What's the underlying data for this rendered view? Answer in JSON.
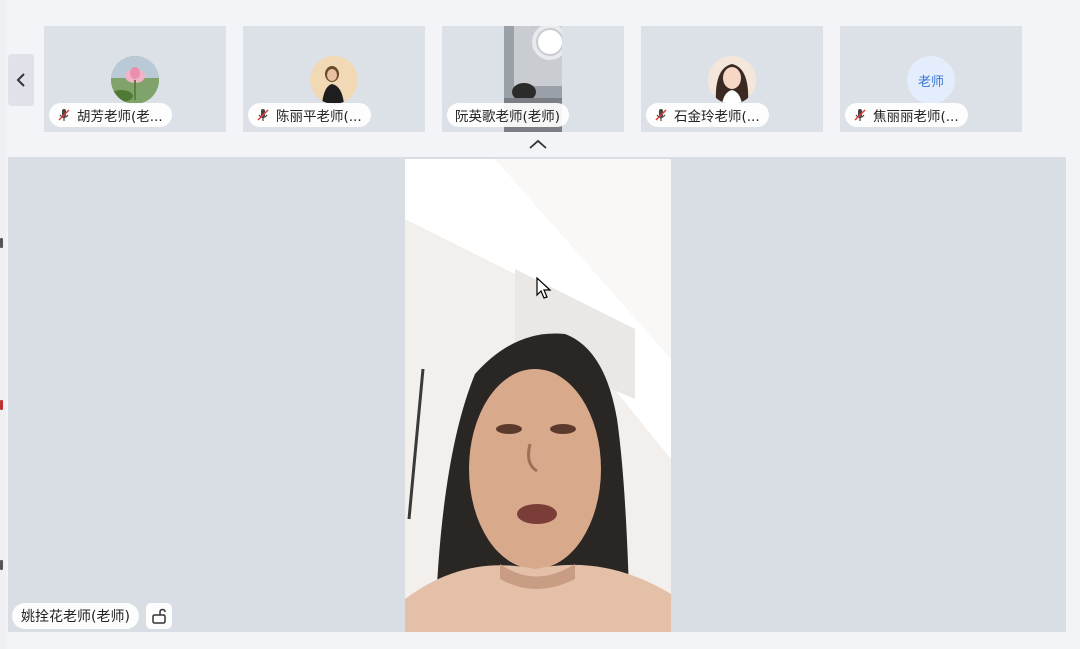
{
  "participants": [
    {
      "name": "胡芳老师(老...",
      "muted": true,
      "avatar": "photo-lotus"
    },
    {
      "name": "陈丽平老师(...",
      "muted": true,
      "avatar": "photo-woman"
    },
    {
      "name": "阮英歌老师(老师)",
      "muted": false,
      "avatar": "live-video"
    },
    {
      "name": "石金玲老师(...",
      "muted": true,
      "avatar": "photo-portrait"
    },
    {
      "name": "焦丽丽老师(...",
      "muted": true,
      "avatar": "text",
      "avatar_text": "老师"
    }
  ],
  "main_speaker": {
    "name": "姚拴花老师(老师)"
  },
  "icons": {
    "prev": "chevron-left-icon",
    "collapse": "chevron-up-icon",
    "mic_muted": "mic-muted-icon",
    "lock": "unlock-icon"
  },
  "colors": {
    "stage_bg": "#d9dee5",
    "tile_bg": "#dce1e8",
    "accent": "#3a76d6"
  }
}
